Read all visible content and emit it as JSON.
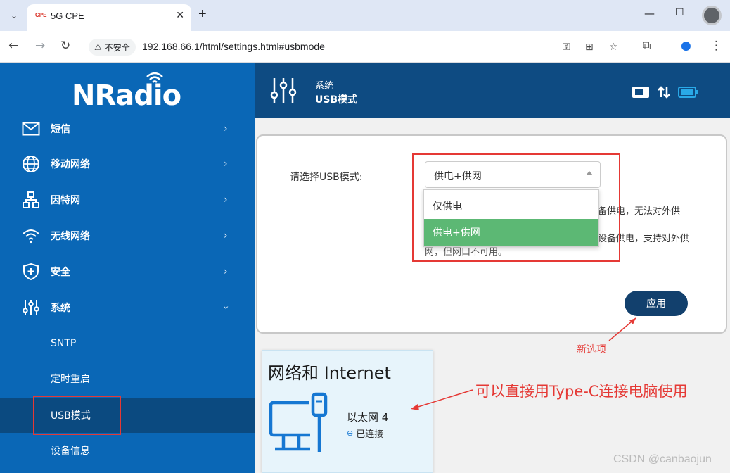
{
  "browser": {
    "tab_title": "5G CPE",
    "tab_favicon": "CPE",
    "security_label": "不安全",
    "url": "192.168.66.1/html/settings.html#usbmode"
  },
  "sidebar": {
    "logo": "NRadio",
    "items": [
      {
        "label": "短信",
        "icon": "mail-icon"
      },
      {
        "label": "移动网络",
        "icon": "globe-icon"
      },
      {
        "label": "因特网",
        "icon": "network-icon"
      },
      {
        "label": "无线网络",
        "icon": "wifi-icon"
      },
      {
        "label": "安全",
        "icon": "shield-plus-icon"
      },
      {
        "label": "系统",
        "icon": "sliders-icon"
      }
    ],
    "sub_items": [
      {
        "label": "SNTP"
      },
      {
        "label": "定时重启"
      },
      {
        "label": "USB模式"
      },
      {
        "label": "设备信息"
      }
    ]
  },
  "header": {
    "section": "系统",
    "page": "USB模式"
  },
  "usb_form": {
    "label": "请选择USB模式:",
    "selected": "供电+供网",
    "options": [
      "仅供电",
      "供电+供网"
    ],
    "desc_line1": "备供电，无法对外供",
    "desc_line2": "设备供电，支持对外供",
    "desc_line3": "网，但网口不可用。",
    "apply_label": "应用"
  },
  "annotations": {
    "new_option": "新选项",
    "typec": "可以直接用Type-C连接电脑使用"
  },
  "network_panel": {
    "title": "网络和 Internet",
    "adapter_name": "以太网 4",
    "status": "已连接"
  },
  "watermark": "CSDN @canbaojun",
  "colors": {
    "sidebar": "#0a67b6",
    "header": "#0e4b82",
    "active_item": "#0b4a80",
    "selected_option": "#5cb874",
    "apply_button": "#12406d",
    "annotation_red": "#e53935"
  }
}
